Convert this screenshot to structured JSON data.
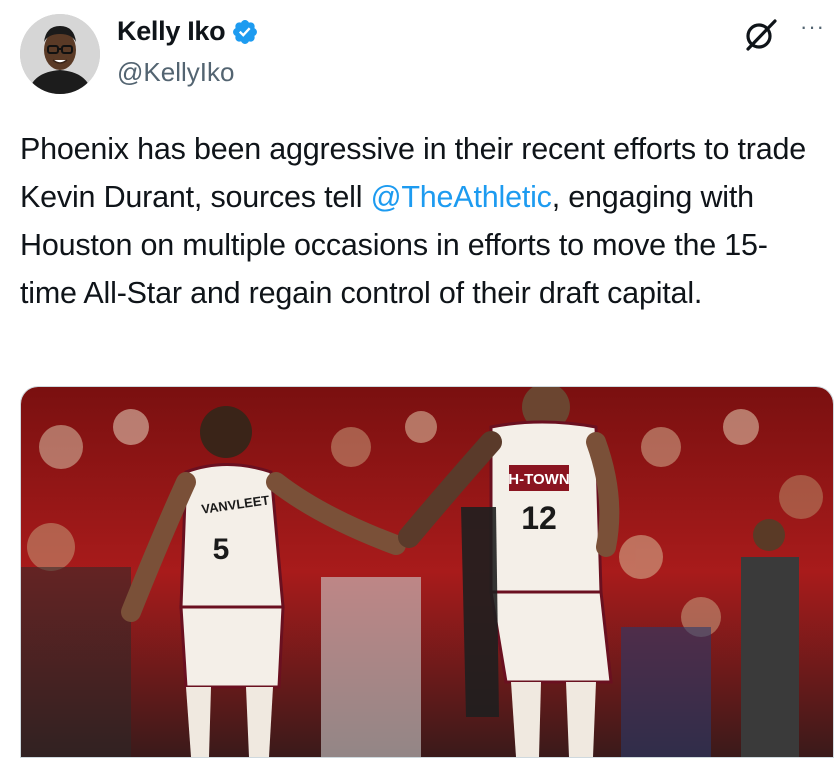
{
  "author": {
    "display_name": "Kelly Iko",
    "handle": "@KellyIko",
    "verified": true,
    "verified_color": "#1d9bf0"
  },
  "header_icons": {
    "grok": "grok-icon",
    "more": "more-horizontal-icon",
    "more_glyph": "···"
  },
  "tweet": {
    "text_before": "Phoenix has been aggressive in their recent efforts to trade Kevin Durant, sources tell ",
    "mention": "@TheAthletic",
    "text_after": ", engaging with Houston on multiple occasions in efforts to move the 15-time All-Star and regain control of their draft capital.",
    "mention_color": "#1d9bf0"
  },
  "media": {
    "left_jersey_name": "VANVLEET",
    "left_jersey_number": "5",
    "right_jersey_wordmark": "H-TOWN",
    "right_jersey_number": "12"
  }
}
